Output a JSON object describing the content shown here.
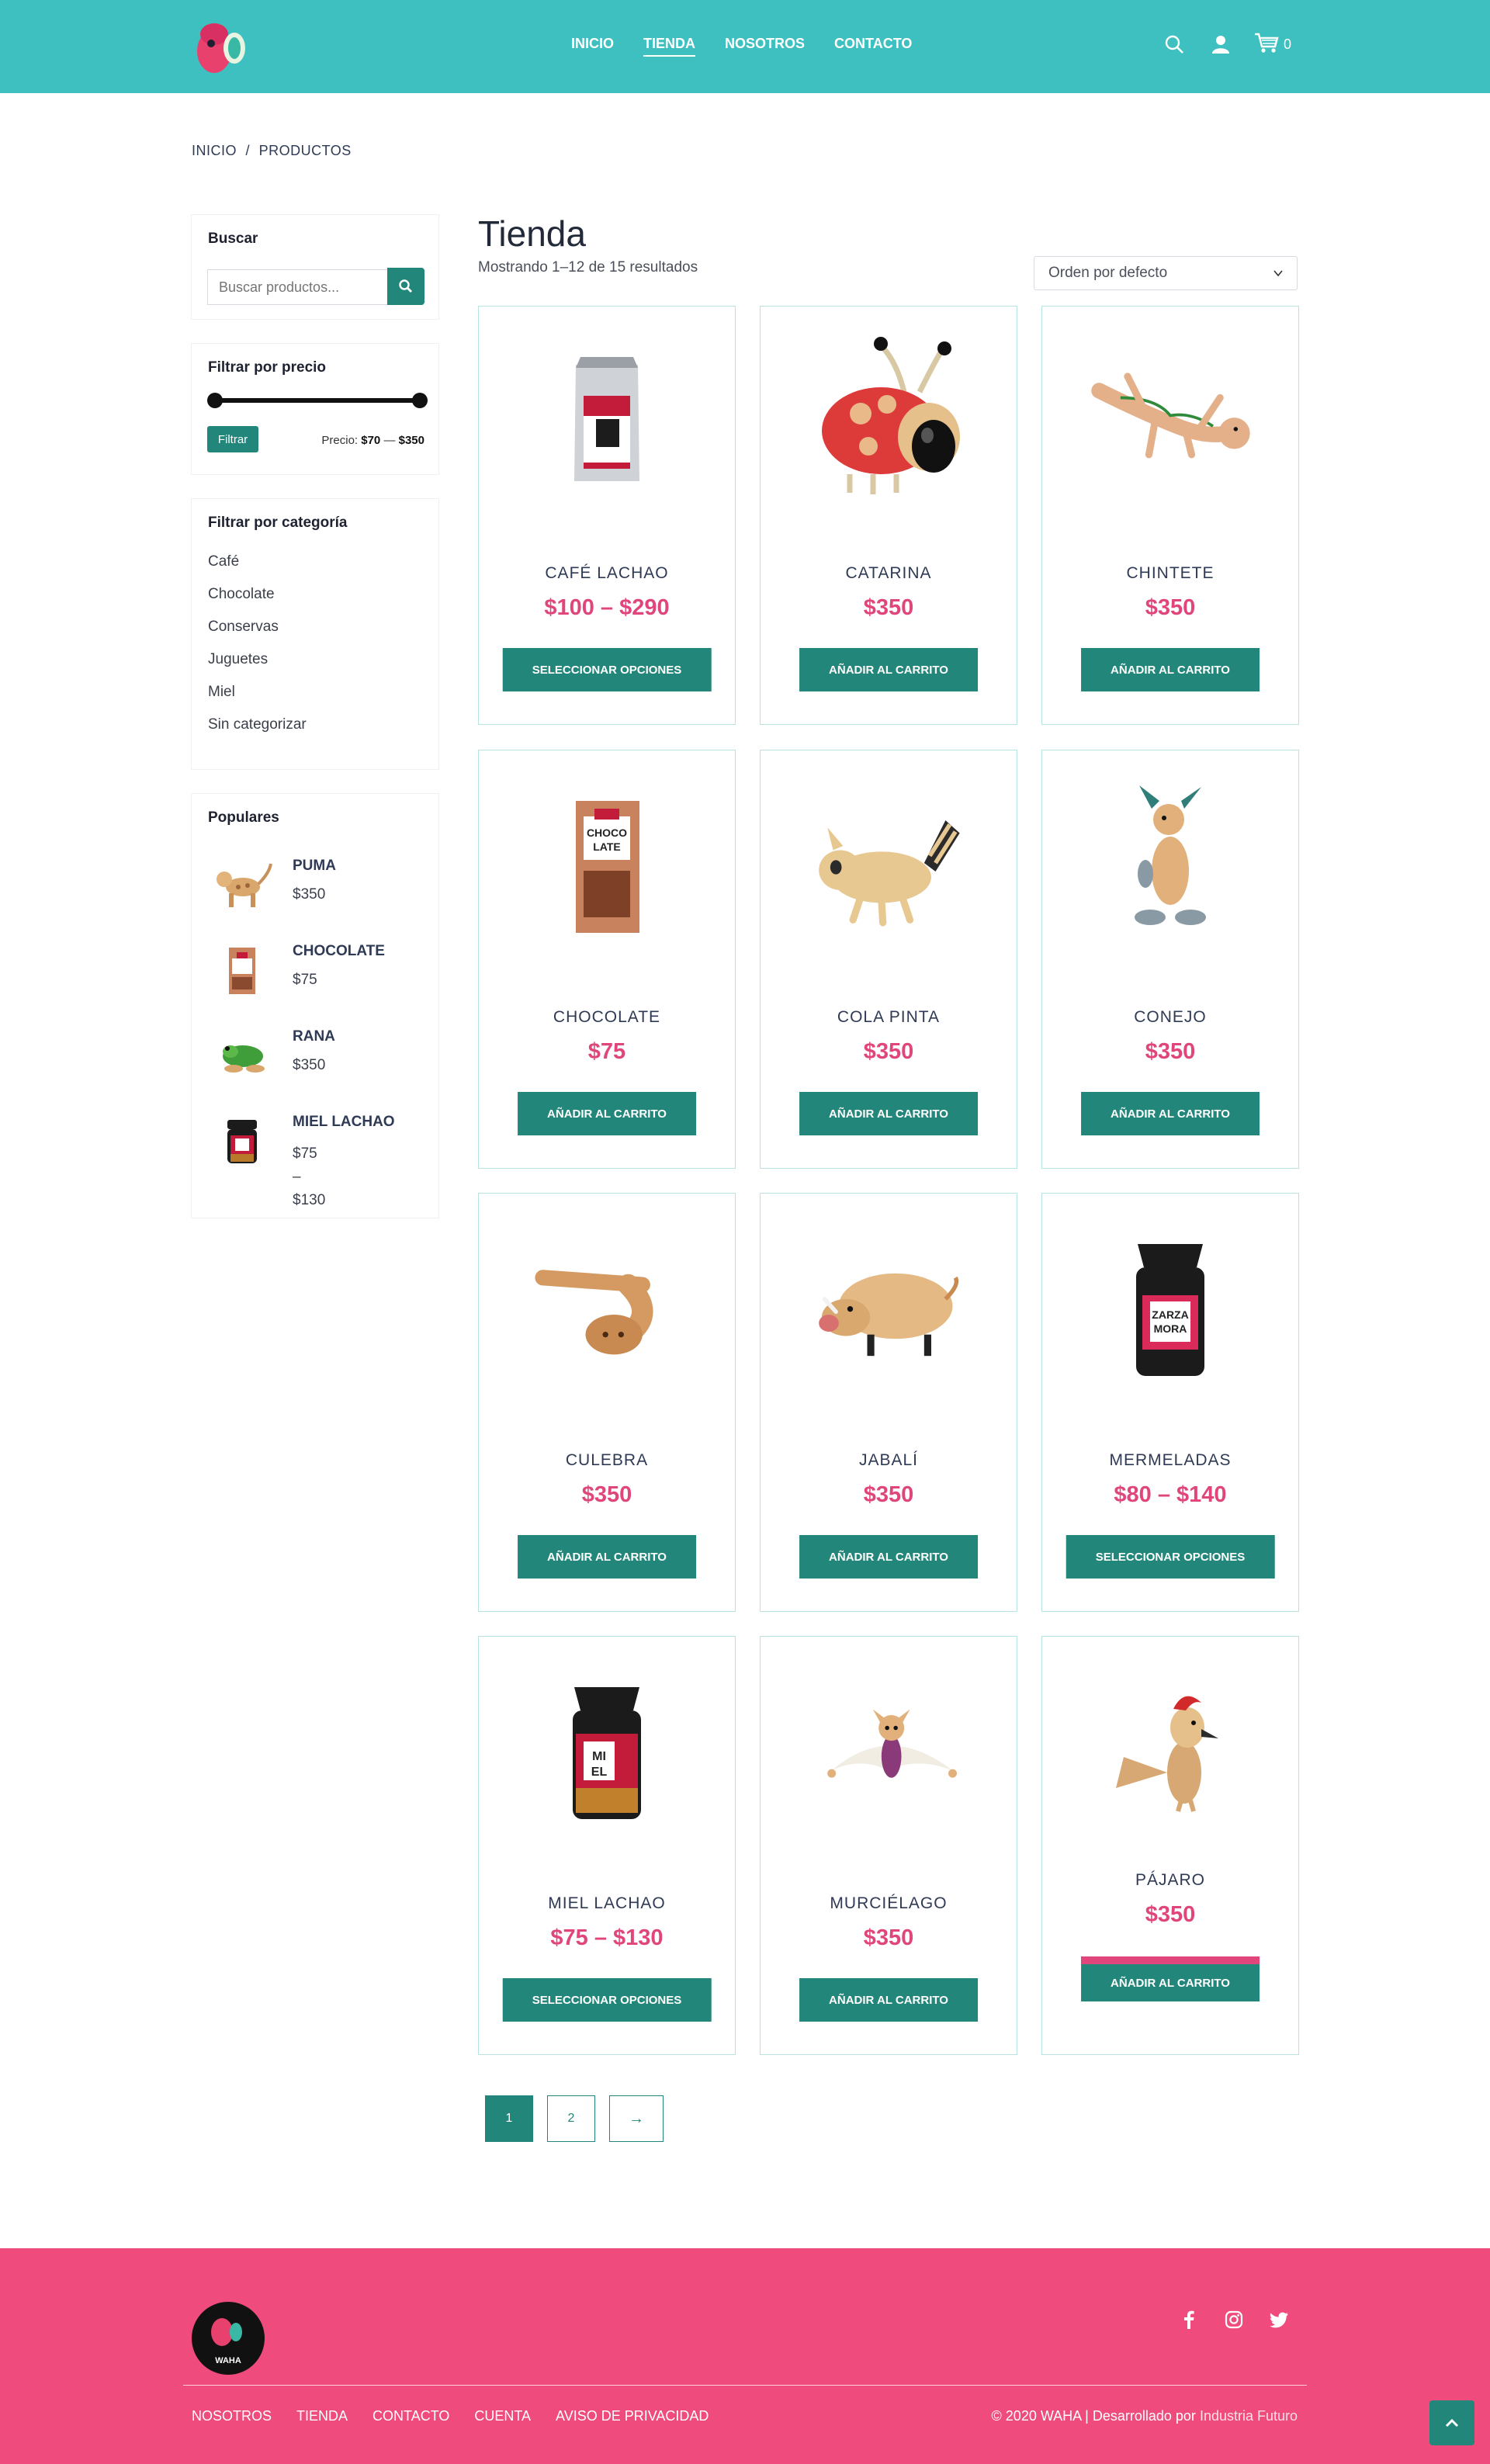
{
  "header": {
    "nav": [
      "INICIO",
      "TIENDA",
      "NOSOTROS",
      "CONTACTO"
    ],
    "active_nav": "TIENDA",
    "cart_count": "0",
    "brand_color": "#3ebfc0"
  },
  "breadcrumb": {
    "home": "INICIO",
    "sep": "/",
    "current": "PRODUCTOS"
  },
  "sidebar": {
    "search": {
      "title": "Buscar",
      "placeholder": "Buscar productos..."
    },
    "price": {
      "title": "Filtrar por precio",
      "button": "Filtrar",
      "label": "Precio:",
      "min": "$70",
      "dash": "—",
      "max": "$350"
    },
    "categories": {
      "title": "Filtrar por categoría",
      "items": [
        "Café",
        "Chocolate",
        "Conservas",
        "Juguetes",
        "Miel",
        "Sin categorizar"
      ]
    },
    "popular": {
      "title": "Populares",
      "items": [
        {
          "name": "PUMA",
          "price": "$350"
        },
        {
          "name": "CHOCOLATE",
          "price": "$75"
        },
        {
          "name": "RANA",
          "price": "$350"
        },
        {
          "name": "MIEL LACHAO",
          "price_lines": [
            "$75",
            "–",
            "$130"
          ]
        }
      ]
    }
  },
  "main": {
    "title": "Tienda",
    "result_count": "Mostrando 1–12 de 15 resultados",
    "order": "Orden por defecto",
    "products": [
      {
        "name": "CAFÉ LACHAO",
        "price": "$100 – $290",
        "button": "SELECCIONAR OPCIONES",
        "icon": "coffee-bag-icon"
      },
      {
        "name": "CATARINA",
        "price": "$350",
        "button": "AÑADIR AL CARRITO",
        "icon": "ladybug-toy-icon"
      },
      {
        "name": "CHINTETE",
        "price": "$350",
        "button": "AÑADIR AL CARRITO",
        "icon": "lizard-toy-icon"
      },
      {
        "name": "CHOCOLATE",
        "price": "$75",
        "button": "AÑADIR AL CARRITO",
        "icon": "chocolate-bag-icon"
      },
      {
        "name": "COLA PINTA",
        "price": "$350",
        "button": "AÑADIR AL CARRITO",
        "icon": "raccoon-toy-icon"
      },
      {
        "name": "CONEJO",
        "price": "$350",
        "button": "AÑADIR AL CARRITO",
        "icon": "rabbit-toy-icon"
      },
      {
        "name": "CULEBRA",
        "price": "$350",
        "button": "AÑADIR AL CARRITO",
        "icon": "snake-toy-icon"
      },
      {
        "name": "JABALÍ",
        "price": "$350",
        "button": "AÑADIR AL CARRITO",
        "icon": "boar-toy-icon"
      },
      {
        "name": "MERMELADAS",
        "price": "$80 – $140",
        "button": "SELECCIONAR OPCIONES",
        "icon": "jam-jar-icon"
      },
      {
        "name": "MIEL LACHAO",
        "price": "$75 – $130",
        "button": "SELECCIONAR OPCIONES",
        "icon": "honey-jar-icon"
      },
      {
        "name": "MURCIÉLAGO",
        "price": "$350",
        "button": "AÑADIR AL CARRITO",
        "icon": "bat-toy-icon"
      },
      {
        "name": "PÁJARO",
        "price": "$350",
        "button": "AÑADIR AL CARRITO",
        "icon": "bird-toy-icon"
      }
    ]
  },
  "pagination": {
    "pages": [
      "1",
      "2"
    ],
    "next": "→",
    "current": "1"
  },
  "footer": {
    "links": [
      "NOSOTROS",
      "TIENDA",
      "CONTACTO",
      "CUENTA",
      "AVISO DE PRIVACIDAD"
    ],
    "copyright": "© 2020 WAHA | Desarrollado por",
    "credit": "Industria Futuro",
    "brand_color": "#ef4b7d",
    "logo_text": "WAHA"
  }
}
